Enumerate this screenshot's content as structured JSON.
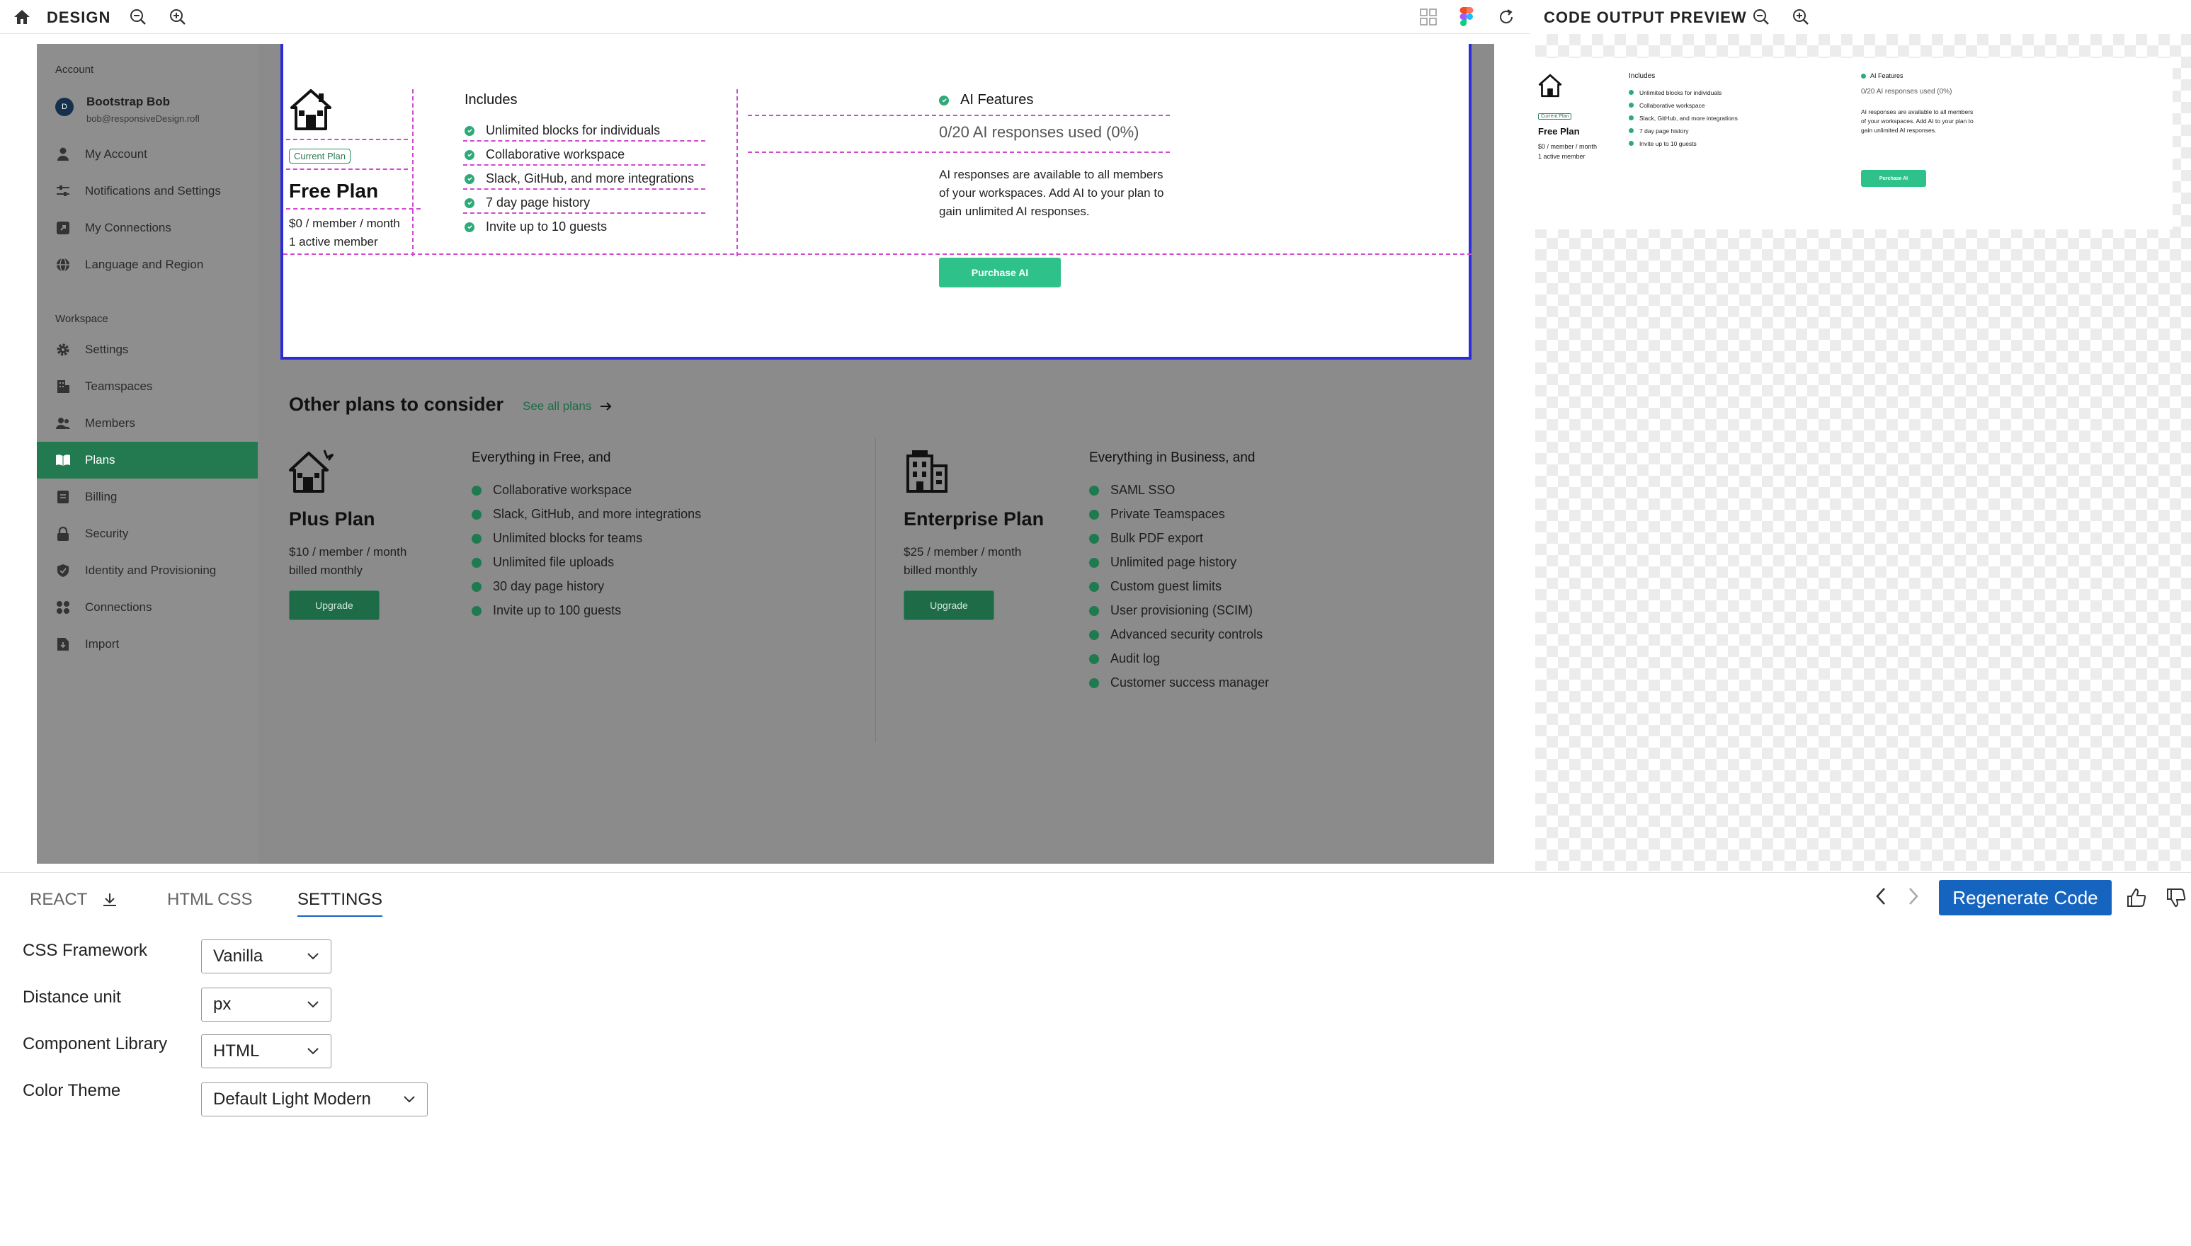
{
  "topbar": {
    "title": "DESIGN"
  },
  "preview_header": {
    "title": "CODE OUTPUT PREVIEW"
  },
  "sidebar": {
    "account_label": "Account",
    "user": {
      "initial": "D",
      "name": "Bootstrap Bob",
      "email": "bob@responsiveDesign.rofl"
    },
    "account_items": [
      {
        "label": "My Account",
        "icon": "user-icon"
      },
      {
        "label": "Notifications and Settings",
        "icon": "sliders-icon"
      },
      {
        "label": "My Connections",
        "icon": "external-link-icon"
      },
      {
        "label": "Language and Region",
        "icon": "globe-icon"
      }
    ],
    "workspace_label": "Workspace",
    "workspace_items": [
      {
        "label": "Settings",
        "icon": "gear-icon"
      },
      {
        "label": "Teamspaces",
        "icon": "building-icon"
      },
      {
        "label": "Members",
        "icon": "members-icon"
      },
      {
        "label": "Plans",
        "icon": "book-icon",
        "active": true
      },
      {
        "label": "Billing",
        "icon": "billing-icon"
      },
      {
        "label": "Security",
        "icon": "lock-icon"
      },
      {
        "label": "Identity and Provisioning",
        "icon": "shield-icon"
      },
      {
        "label": "Connections",
        "icon": "grid-icon"
      },
      {
        "label": "Import",
        "icon": "import-icon"
      }
    ]
  },
  "free_plan": {
    "badge": "Current Plan",
    "name": "Free Plan",
    "price": "$0 / member / month",
    "members": "1 active member",
    "includes_title": "Includes",
    "features": [
      "Unlimited blocks for individuals",
      "Collaborative workspace",
      "Slack, GitHub, and more integrations",
      "7 day page history",
      "Invite up to 10 guests"
    ],
    "ai_title": "AI Features",
    "ai_usage": "0/20 AI responses used (0%)",
    "ai_desc_lines": [
      "AI responses are available to all members",
      "of your workspaces. Add AI to your plan to",
      "gain unlimited AI responses."
    ],
    "ai_button": "Purchase AI"
  },
  "other_plans": {
    "title": "Other plans to consider",
    "see_all": "See all plans",
    "plus": {
      "name": "Plus Plan",
      "price": "$10 / member / month",
      "billing": "billed monthly",
      "button": "Upgrade",
      "features_title": "Everything in Free, and",
      "features": [
        "Collaborative workspace",
        "Slack, GitHub, and more integrations",
        "Unlimited blocks for teams",
        "Unlimited file uploads",
        "30 day page history",
        "Invite up to 100 guests"
      ]
    },
    "enterprise": {
      "name": "Enterprise Plan",
      "price": "$25 / member / month",
      "billing": "billed monthly",
      "button": "Upgrade",
      "features_title": "Everything in Business, and",
      "features": [
        "SAML SSO",
        "Private Teamspaces",
        "Bulk PDF export",
        "Unlimited page history",
        "Custom guest limits",
        "User provisioning (SCIM)",
        "Advanced security controls",
        "Audit log",
        "Customer success manager"
      ]
    }
  },
  "bottom": {
    "tabs": [
      "REACT",
      "HTML CSS",
      "SETTINGS"
    ],
    "active_tab": "SETTINGS",
    "settings": [
      {
        "label": "CSS Framework",
        "value": "Vanilla"
      },
      {
        "label": "Distance unit",
        "value": "px"
      },
      {
        "label": "Component Library",
        "value": "HTML"
      },
      {
        "label": "Color Theme",
        "value": "Default Light Modern"
      }
    ],
    "regenerate": "Regenerate Code"
  },
  "colors": {
    "accent_green": "#2ec28a",
    "dark_green": "#237a50",
    "primary_blue": "#1565c0",
    "selection_border": "#2b2bd8",
    "guide_magenta": "#d04ad0"
  }
}
